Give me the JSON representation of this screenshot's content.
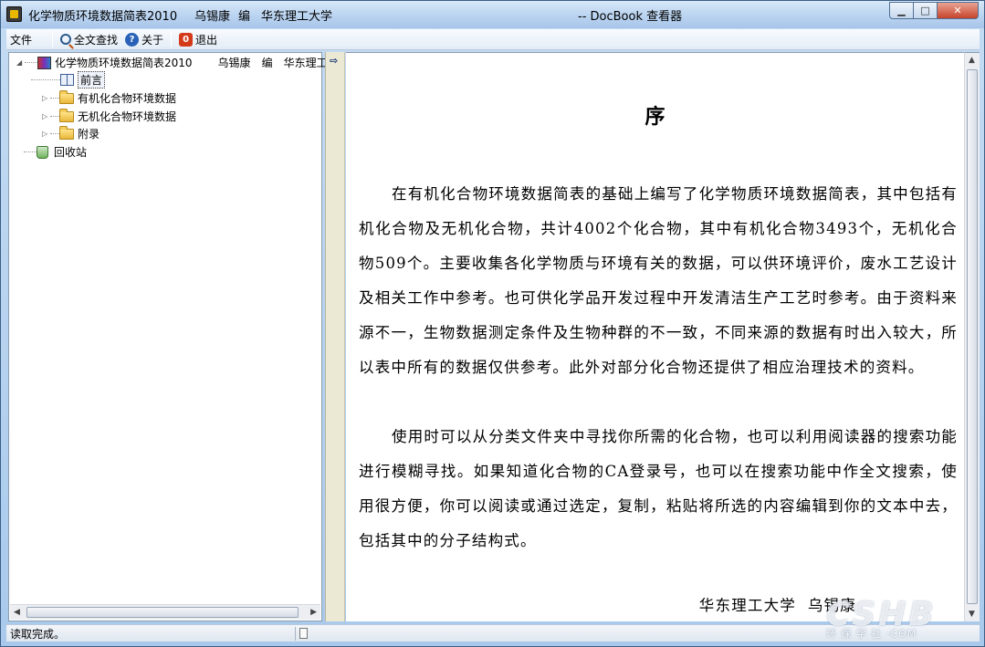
{
  "titlebar": {
    "doc_title": "化学物质环境数据简表2010",
    "author": "乌锡康",
    "role": "编",
    "org": "华东理工大学",
    "app_title": "-- DocBook 查看器",
    "minimize": "▁",
    "maximize": "□",
    "close": "✕"
  },
  "toolbar": {
    "file_label": "文件",
    "search_label": "全文查找",
    "about_label": "关于",
    "exit_label": "退出",
    "help_glyph": "?",
    "exit_glyph": "0"
  },
  "tree": {
    "root_label": "化学物质环境数据简表2010",
    "root_author": "乌锡康",
    "root_role": "编",
    "root_org": "华东理工",
    "items": [
      {
        "label": "前言"
      },
      {
        "label": "有机化合物环境数据"
      },
      {
        "label": "无机化合物环境数据"
      },
      {
        "label": "附录"
      }
    ],
    "recycle_label": "回收站"
  },
  "document": {
    "heading": "序",
    "paragraphs": [
      "在有机化合物环境数据简表的基础上编写了化学物质环境数据简表，其中包括有机化合物及无机化合物，共计4002个化合物，其中有机化合物3493个，无机化合物509个。主要收集各化学物质与环境有关的数据，可以供环境评价，废水工艺设计及相关工作中参考。也可供化学品开发过程中开发清洁生产工艺时参考。由于资料来源不一，生物数据测定条件及生物种群的不一致，不同来源的数据有时出入较大，所以表中所有的数据仅供参考。此外对部分化合物还提供了相应治理技术的资料。",
      "使用时可以从分类文件夹中寻找你所需的化合物，也可以利用阅读器的搜索功能进行模糊寻找。如果知道化合物的CA登录号，也可以在搜索功能中作全文搜索，使用很方便，你可以阅读或通过选定，复制，粘贴将所选的内容编辑到你的文本中去，包括其中的分子结构式。"
    ],
    "signature": "华东理工大学  乌锡康"
  },
  "status": {
    "text": "读取完成。"
  },
  "watermark": {
    "big": "CSHB",
    "small": "环 保 学 社 ·COM"
  },
  "colors": {
    "title_gradient_top": "#d8e8f8",
    "close_button": "#c7432b",
    "gutter": "#ebe9d3"
  },
  "icons": [
    "app-icon",
    "search-icon",
    "help-icon",
    "exit-icon",
    "book-icon",
    "page-icon",
    "folder-icon",
    "recycle-bin-icon",
    "sync-arrow-icon",
    "status-doc-icon"
  ]
}
